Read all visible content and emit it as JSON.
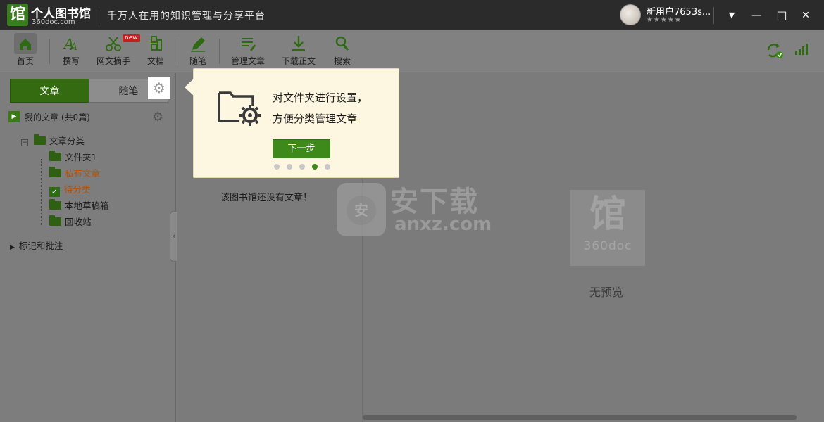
{
  "titlebar": {
    "logo_glyph": "馆",
    "app_name": "个人图书馆",
    "app_domain": "360doc.com",
    "slogan": "千万人在用的知识管理与分享平台",
    "username": "新用户7653s...",
    "stars": "★★★★★",
    "controls": {
      "menu": "▼",
      "minimize": "—",
      "maximize": "□",
      "close": "✕"
    }
  },
  "toolbar": {
    "items": [
      {
        "label": "首页",
        "icon": "home-icon"
      },
      {
        "label": "撰写",
        "icon": "write-icon"
      },
      {
        "label": "网文摘手",
        "icon": "scissors-icon",
        "badge": "new"
      },
      {
        "label": "文档",
        "icon": "document-icon"
      },
      {
        "label": "随笔",
        "icon": "pencil-icon"
      },
      {
        "label": "管理文章",
        "icon": "manage-icon"
      },
      {
        "label": "下载正文",
        "icon": "download-icon"
      },
      {
        "label": "搜索",
        "icon": "search-icon"
      }
    ],
    "right_icons": [
      "sync-icon",
      "signal-icon"
    ]
  },
  "left": {
    "tabs": {
      "article": "文章",
      "note": "随笔"
    },
    "my_articles": "我的文章 (共0篇)",
    "tree": {
      "root": "文章分类",
      "children": [
        "文件夹1",
        "私有文章",
        "待分类",
        "本地草稿箱",
        "回收站"
      ]
    },
    "marks": "标记和批注"
  },
  "list": {
    "empty": "该图书馆还没有文章！"
  },
  "preview": {
    "logo_glyph": "馆",
    "logo_brand": "360doc",
    "empty": "无预览"
  },
  "popup": {
    "line1": "对文件夹进行设置，",
    "line2": "方便分类管理文章",
    "next": "下一步",
    "step_current": 4,
    "step_total": 5
  },
  "watermark": {
    "shield": "安",
    "main": "安下载",
    "sub": "anxz.com"
  },
  "colors": {
    "accent": "#3d8a1a",
    "popup_bg": "#fdf6e1",
    "orange": "#b84f05"
  }
}
